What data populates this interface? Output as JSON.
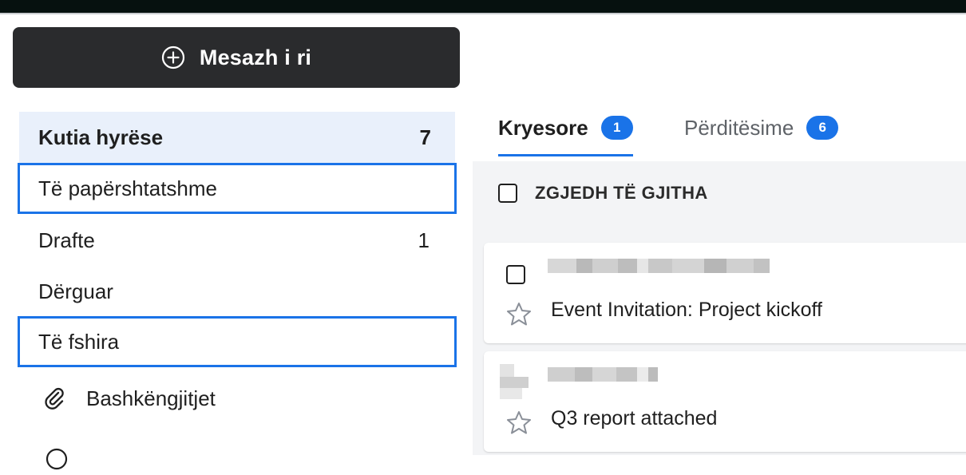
{
  "compose": {
    "label": "Mesazh i ri",
    "icon": "plus-circle-icon"
  },
  "nav": {
    "items": [
      {
        "label": "Kutia hyrëse",
        "count": "7"
      },
      {
        "label": "Të papërshtatshme",
        "count": ""
      },
      {
        "label": "Drafte",
        "count": "1"
      },
      {
        "label": "Dërguar",
        "count": ""
      },
      {
        "label": "Të fshira",
        "count": ""
      },
      {
        "label": "Bashkëngjitjet",
        "count": "",
        "icon": "paperclip-icon"
      }
    ]
  },
  "tabs": [
    {
      "label": "Kryesore",
      "badge": "1"
    },
    {
      "label": "Përditësime",
      "badge": "6"
    }
  ],
  "select_all": {
    "label": "ZGJEDH TË GJITHA"
  },
  "messages": [
    {
      "subject": "Event Invitation: Project kickoff"
    },
    {
      "subject": "Q3 report attached"
    }
  ],
  "colors": {
    "accent": "#1a73e8",
    "compose_bg": "#2a2b2d",
    "active_nav_bg": "#e9f0fb",
    "panel_bg": "#f3f4f6"
  }
}
